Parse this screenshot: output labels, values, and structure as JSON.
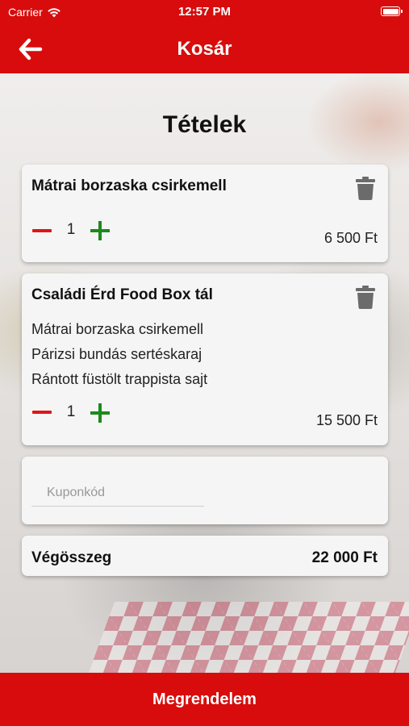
{
  "status_bar": {
    "carrier": "Carrier",
    "time": "12:57 PM"
  },
  "header": {
    "title": "Kosár",
    "back_icon": "arrow-left-icon"
  },
  "section_title": "Tételek",
  "cart_items": [
    {
      "name": "Mátrai borzaska csirkemell",
      "quantity": "1",
      "price": "6 500 Ft",
      "sub_items": []
    },
    {
      "name": "Családi Érd Food Box tál",
      "quantity": "1",
      "price": "15 500 Ft",
      "sub_items": [
        "Mátrai borzaska csirkemell",
        "Párizsi bundás sertéskaraj",
        "Rántott füstölt trappista sajt"
      ]
    }
  ],
  "coupon": {
    "placeholder": "Kuponkód",
    "value": ""
  },
  "total": {
    "label": "Végösszeg",
    "value": "22 000 Ft"
  },
  "order_button": {
    "label": "Megrendelem"
  },
  "colors": {
    "brand_red": "#d80c0c",
    "minus_red": "#e01515",
    "plus_green": "#1c8a1c"
  }
}
